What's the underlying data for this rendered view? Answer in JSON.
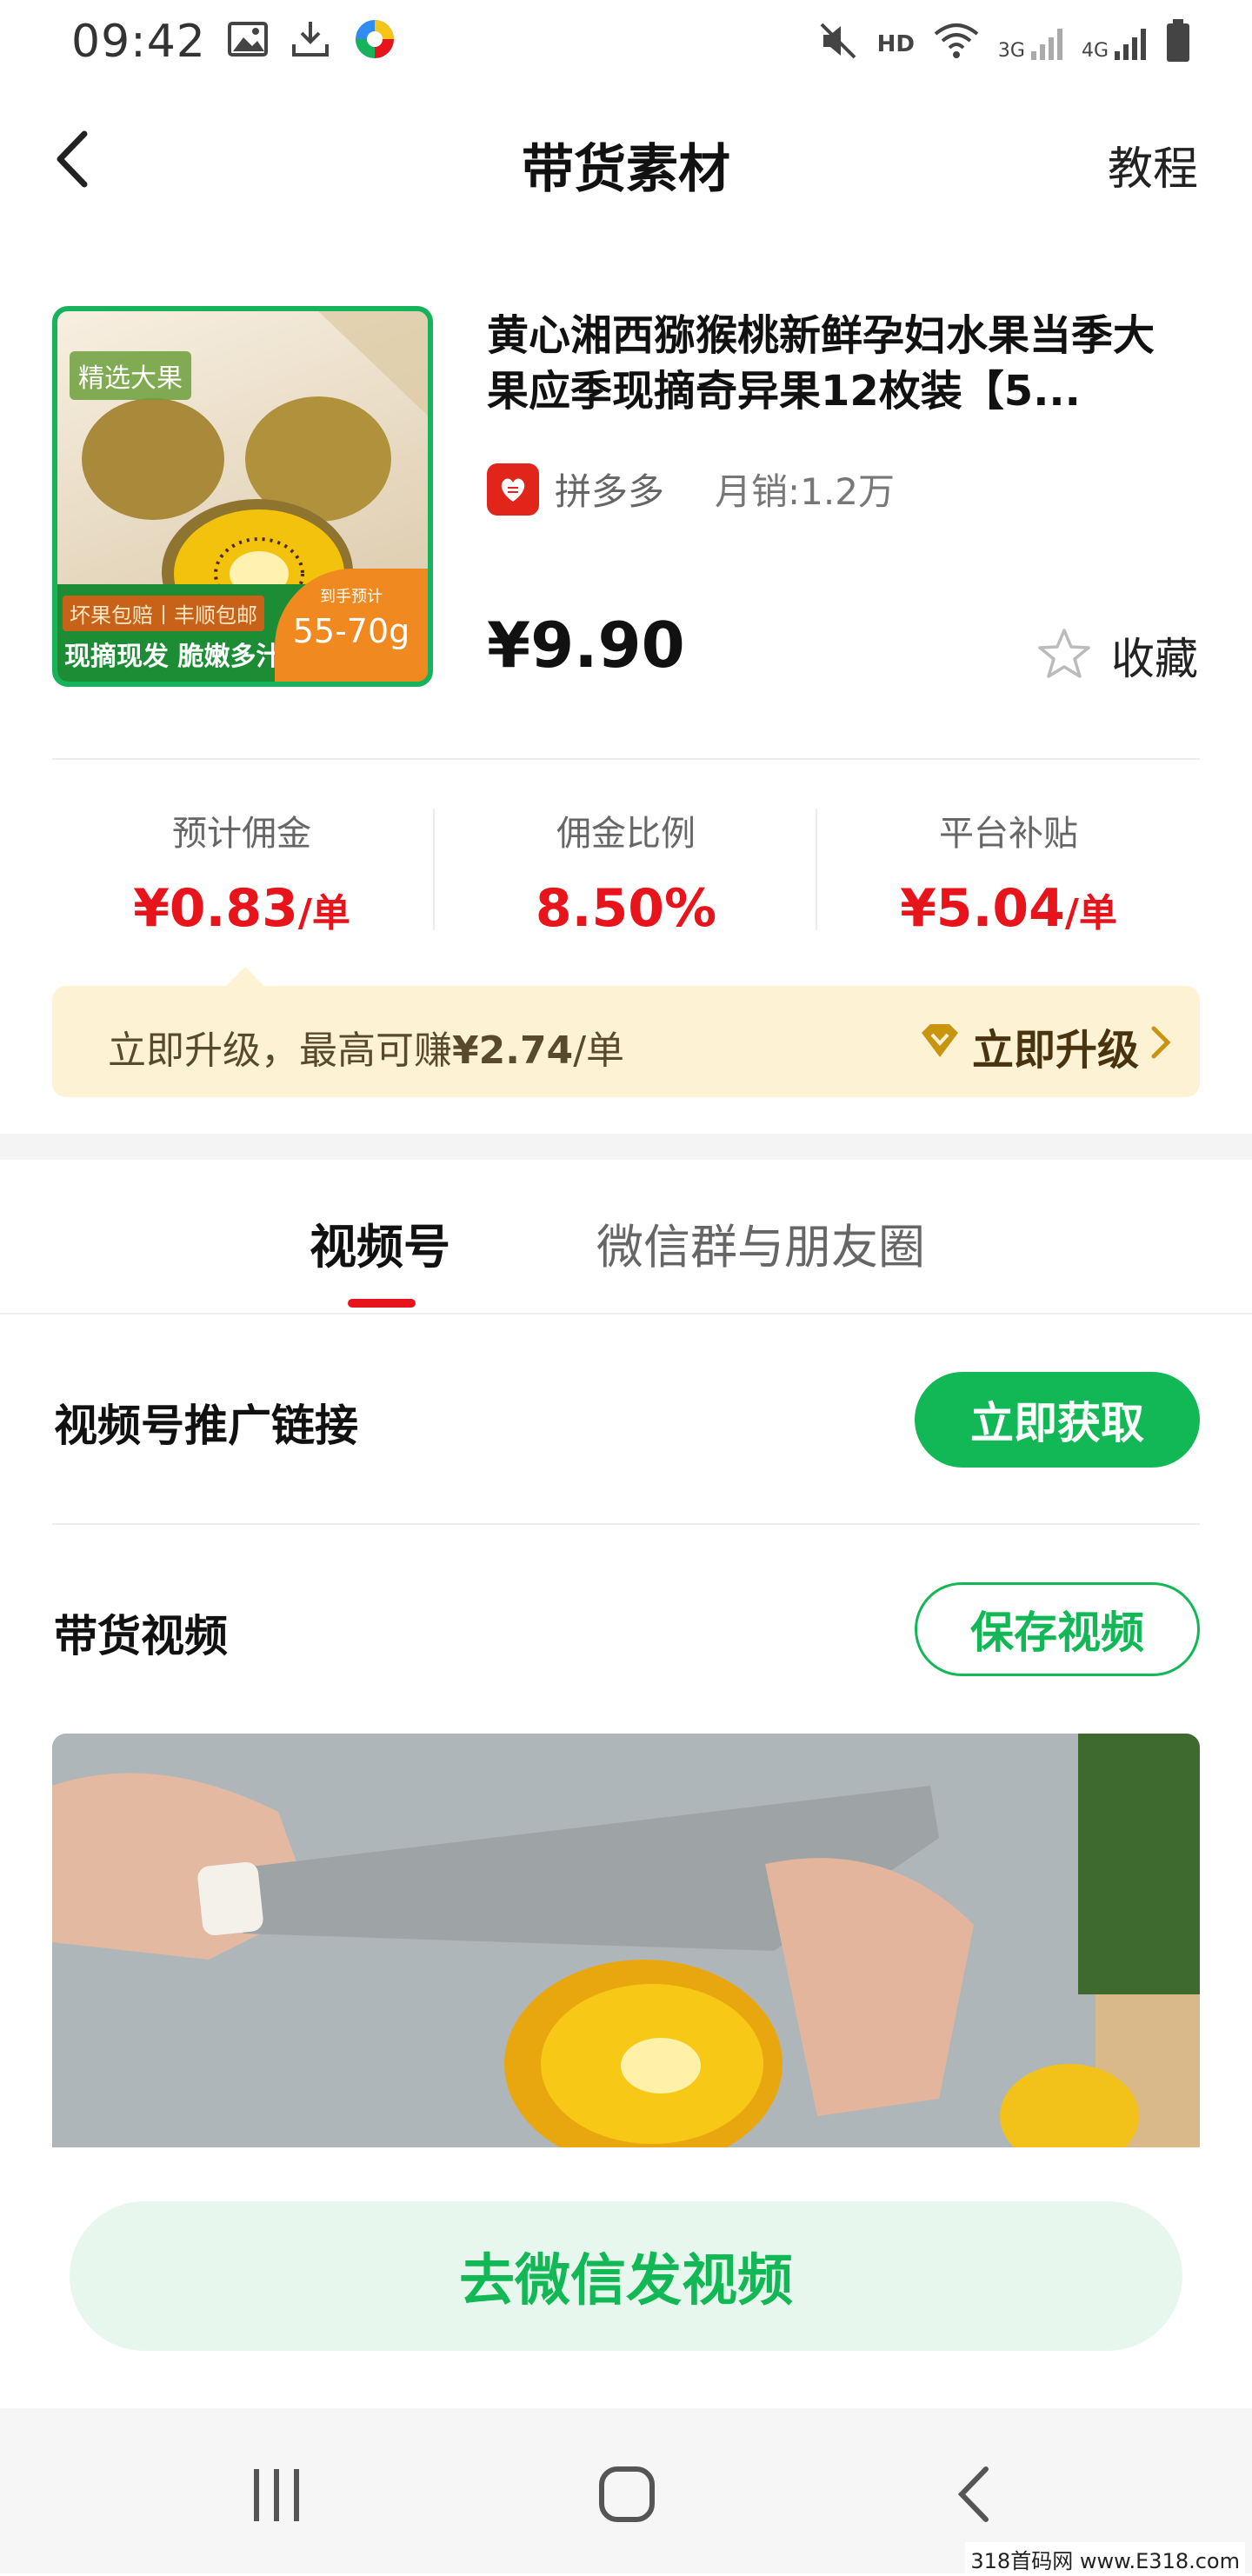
{
  "status_bar": {
    "time": "09:42",
    "left_icons": [
      "image-icon",
      "download-icon",
      "app-icon"
    ],
    "right_icons": [
      "mute-icon",
      "hd-icon",
      "wifi-icon",
      "signal-3g-icon",
      "signal-4g-icon",
      "battery-icon"
    ],
    "hd_label": "HD",
    "net_3g": "3G",
    "net_4g": "4G"
  },
  "header": {
    "back_icon": "chevron-left-icon",
    "title": "带货素材",
    "tutorial_label": "教程"
  },
  "product": {
    "image_badge": "精选大果",
    "image_strip_top": "坏果包赔丨丰顺包邮",
    "image_strip_main": "现摘现发 脆嫩多汁",
    "image_weight_small": "到手预计",
    "image_weight": "55-70g",
    "title": "黄心湘西猕猴桃新鲜孕妇水果当季大果应季现摘奇异果12枚装【5...",
    "shop_name": "拼多多",
    "monthly_sales": "月销:1.2万",
    "price": "¥9.90",
    "favorite_label": "收藏"
  },
  "stats": [
    {
      "label": "预计佣金",
      "value": "¥0.83",
      "unit": "/单"
    },
    {
      "label": "佣金比例",
      "value": "8.50%",
      "unit": ""
    },
    {
      "label": "平台补贴",
      "value": "¥5.04",
      "unit": "/单"
    }
  ],
  "upgrade": {
    "prefix": "立即升级，最高可赚",
    "amount": "¥2.74",
    "suffix": "/单",
    "action_label": "立即升级"
  },
  "tabs": [
    {
      "label": "视频号",
      "active": true
    },
    {
      "label": "微信群与朋友圈",
      "active": false
    }
  ],
  "video_channel": {
    "promo_link_title": "视频号推广链接",
    "get_now_label": "立即获取",
    "video_title": "带货视频",
    "save_video_label": "保存视频"
  },
  "cta": {
    "label": "去微信发视频"
  },
  "watermark": "318首码网 www.E318.com",
  "colors": {
    "accent_green": "#12b855",
    "price_red": "#e8141c",
    "banner_bg": "#fdf3d4"
  }
}
